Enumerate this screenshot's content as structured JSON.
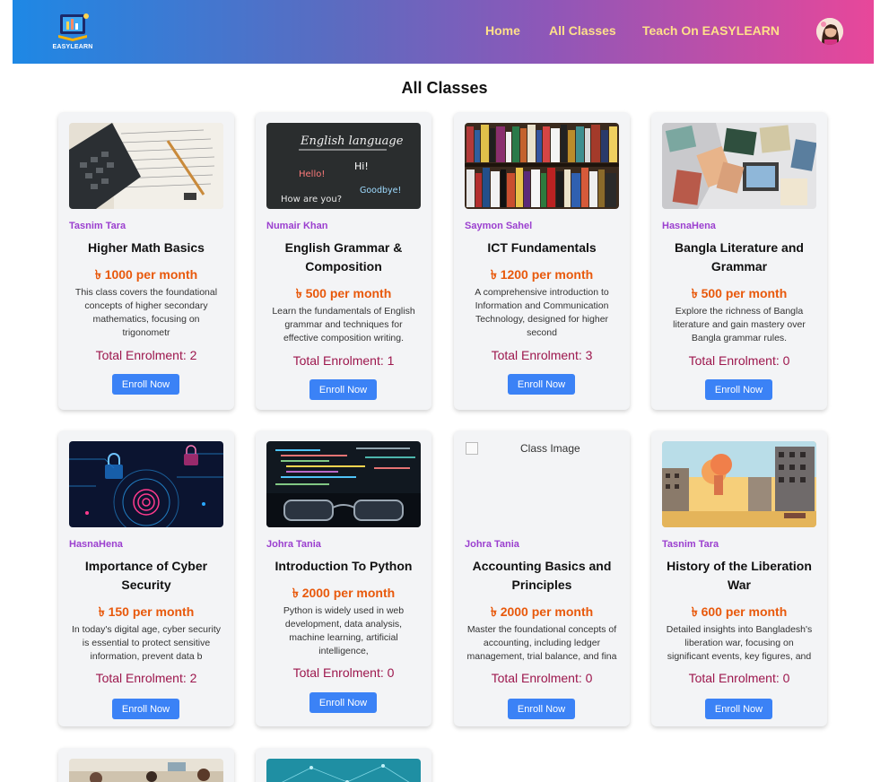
{
  "nav": {
    "logo_text": "EASYLEARN",
    "links": [
      "Home",
      "All Classes",
      "Teach On EASYLEARN"
    ]
  },
  "page": {
    "title": "All Classes"
  },
  "enroll_label": "Enroll Now",
  "cards": [
    {
      "image": "calculator-notebook-photo",
      "teacher": "Tasnim Tara",
      "title": "Higher Math Basics",
      "price": "৳ 1000 per month",
      "description": "This class covers the foundational concepts of higher secondary mathematics, focusing on trigonometr",
      "enrolment": "Total Enrolment: 2"
    },
    {
      "image": "chalkboard-english-photo",
      "teacher": "Numair Khan",
      "title": "English Grammar & Composition",
      "price": "৳ 500 per month",
      "description": "Learn the fundamentals of English grammar and techniques for effective composition writing.",
      "enrolment": "Total Enrolment: 1",
      "chalkboard": [
        "English language",
        "Hi!",
        "Hello!",
        "How are you?",
        "Goodbye!"
      ]
    },
    {
      "image": "bookshelf-photo",
      "teacher": "Saymon Sahel",
      "title": "ICT Fundamentals",
      "price": "৳ 1200 per month",
      "description": "A comprehensive introduction to Information and Communication Technology, designed for higher second",
      "enrolment": "Total Enrolment: 3"
    },
    {
      "image": "reading-books-photo",
      "teacher": "HasnaHena",
      "title": "Bangla Literature and Grammar",
      "price": "৳ 500 per month",
      "description": "Explore the richness of Bangla literature and gain mastery over Bangla grammar rules.",
      "enrolment": "Total Enrolment: 0"
    },
    {
      "image": "cyber-lock-illustration",
      "teacher": "HasnaHena",
      "title": "Importance of Cyber Security",
      "price": "৳ 150 per month",
      "description": "In today's digital age, cyber security is essential to protect sensitive information, prevent data b",
      "enrolment": "Total Enrolment: 2"
    },
    {
      "image": "code-monitor-glasses-photo",
      "teacher": "Johra Tania",
      "title": "Introduction To Python",
      "price": "৳ 2000 per month",
      "description": "Python is widely used in web development, data analysis, machine learning, artificial intelligence,",
      "enrolment": "Total Enrolment: 0"
    },
    {
      "image": "broken-image",
      "image_alt": "Class Image",
      "teacher": "Johra Tania",
      "title": "Accounting Basics and Principles",
      "price": "৳ 2000 per month",
      "description": "Master the foundational concepts of accounting, including ledger management, trial balance, and fina",
      "enrolment": "Total Enrolment: 0"
    },
    {
      "image": "war-city-illustration",
      "teacher": "Tasnim Tara",
      "title": "History of the Liberation War",
      "price": "৳ 600 per month",
      "description": "Detailed insights into Bangladesh's liberation war, focusing on significant events, key figures, and",
      "enrolment": "Total Enrolment: 0"
    },
    {
      "image": "classroom-photo"
    },
    {
      "image": "network-pattern-illustration"
    }
  ]
}
